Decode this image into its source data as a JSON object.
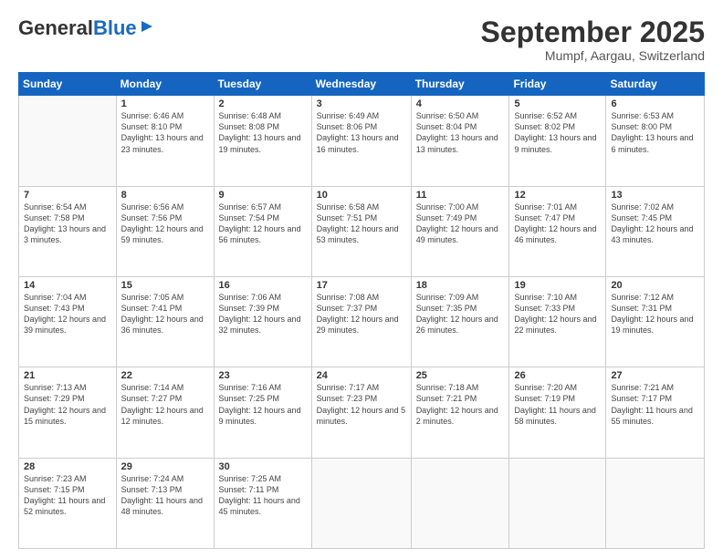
{
  "header": {
    "logo_general": "General",
    "logo_blue": "Blue",
    "month": "September 2025",
    "location": "Mumpf, Aargau, Switzerland"
  },
  "days_of_week": [
    "Sunday",
    "Monday",
    "Tuesday",
    "Wednesday",
    "Thursday",
    "Friday",
    "Saturday"
  ],
  "weeks": [
    [
      {
        "day": "",
        "sunrise": "",
        "sunset": "",
        "daylight": ""
      },
      {
        "day": "1",
        "sunrise": "Sunrise: 6:46 AM",
        "sunset": "Sunset: 8:10 PM",
        "daylight": "Daylight: 13 hours and 23 minutes."
      },
      {
        "day": "2",
        "sunrise": "Sunrise: 6:48 AM",
        "sunset": "Sunset: 8:08 PM",
        "daylight": "Daylight: 13 hours and 19 minutes."
      },
      {
        "day": "3",
        "sunrise": "Sunrise: 6:49 AM",
        "sunset": "Sunset: 8:06 PM",
        "daylight": "Daylight: 13 hours and 16 minutes."
      },
      {
        "day": "4",
        "sunrise": "Sunrise: 6:50 AM",
        "sunset": "Sunset: 8:04 PM",
        "daylight": "Daylight: 13 hours and 13 minutes."
      },
      {
        "day": "5",
        "sunrise": "Sunrise: 6:52 AM",
        "sunset": "Sunset: 8:02 PM",
        "daylight": "Daylight: 13 hours and 9 minutes."
      },
      {
        "day": "6",
        "sunrise": "Sunrise: 6:53 AM",
        "sunset": "Sunset: 8:00 PM",
        "daylight": "Daylight: 13 hours and 6 minutes."
      }
    ],
    [
      {
        "day": "7",
        "sunrise": "Sunrise: 6:54 AM",
        "sunset": "Sunset: 7:58 PM",
        "daylight": "Daylight: 13 hours and 3 minutes."
      },
      {
        "day": "8",
        "sunrise": "Sunrise: 6:56 AM",
        "sunset": "Sunset: 7:56 PM",
        "daylight": "Daylight: 12 hours and 59 minutes."
      },
      {
        "day": "9",
        "sunrise": "Sunrise: 6:57 AM",
        "sunset": "Sunset: 7:54 PM",
        "daylight": "Daylight: 12 hours and 56 minutes."
      },
      {
        "day": "10",
        "sunrise": "Sunrise: 6:58 AM",
        "sunset": "Sunset: 7:51 PM",
        "daylight": "Daylight: 12 hours and 53 minutes."
      },
      {
        "day": "11",
        "sunrise": "Sunrise: 7:00 AM",
        "sunset": "Sunset: 7:49 PM",
        "daylight": "Daylight: 12 hours and 49 minutes."
      },
      {
        "day": "12",
        "sunrise": "Sunrise: 7:01 AM",
        "sunset": "Sunset: 7:47 PM",
        "daylight": "Daylight: 12 hours and 46 minutes."
      },
      {
        "day": "13",
        "sunrise": "Sunrise: 7:02 AM",
        "sunset": "Sunset: 7:45 PM",
        "daylight": "Daylight: 12 hours and 43 minutes."
      }
    ],
    [
      {
        "day": "14",
        "sunrise": "Sunrise: 7:04 AM",
        "sunset": "Sunset: 7:43 PM",
        "daylight": "Daylight: 12 hours and 39 minutes."
      },
      {
        "day": "15",
        "sunrise": "Sunrise: 7:05 AM",
        "sunset": "Sunset: 7:41 PM",
        "daylight": "Daylight: 12 hours and 36 minutes."
      },
      {
        "day": "16",
        "sunrise": "Sunrise: 7:06 AM",
        "sunset": "Sunset: 7:39 PM",
        "daylight": "Daylight: 12 hours and 32 minutes."
      },
      {
        "day": "17",
        "sunrise": "Sunrise: 7:08 AM",
        "sunset": "Sunset: 7:37 PM",
        "daylight": "Daylight: 12 hours and 29 minutes."
      },
      {
        "day": "18",
        "sunrise": "Sunrise: 7:09 AM",
        "sunset": "Sunset: 7:35 PM",
        "daylight": "Daylight: 12 hours and 26 minutes."
      },
      {
        "day": "19",
        "sunrise": "Sunrise: 7:10 AM",
        "sunset": "Sunset: 7:33 PM",
        "daylight": "Daylight: 12 hours and 22 minutes."
      },
      {
        "day": "20",
        "sunrise": "Sunrise: 7:12 AM",
        "sunset": "Sunset: 7:31 PM",
        "daylight": "Daylight: 12 hours and 19 minutes."
      }
    ],
    [
      {
        "day": "21",
        "sunrise": "Sunrise: 7:13 AM",
        "sunset": "Sunset: 7:29 PM",
        "daylight": "Daylight: 12 hours and 15 minutes."
      },
      {
        "day": "22",
        "sunrise": "Sunrise: 7:14 AM",
        "sunset": "Sunset: 7:27 PM",
        "daylight": "Daylight: 12 hours and 12 minutes."
      },
      {
        "day": "23",
        "sunrise": "Sunrise: 7:16 AM",
        "sunset": "Sunset: 7:25 PM",
        "daylight": "Daylight: 12 hours and 9 minutes."
      },
      {
        "day": "24",
        "sunrise": "Sunrise: 7:17 AM",
        "sunset": "Sunset: 7:23 PM",
        "daylight": "Daylight: 12 hours and 5 minutes."
      },
      {
        "day": "25",
        "sunrise": "Sunrise: 7:18 AM",
        "sunset": "Sunset: 7:21 PM",
        "daylight": "Daylight: 12 hours and 2 minutes."
      },
      {
        "day": "26",
        "sunrise": "Sunrise: 7:20 AM",
        "sunset": "Sunset: 7:19 PM",
        "daylight": "Daylight: 11 hours and 58 minutes."
      },
      {
        "day": "27",
        "sunrise": "Sunrise: 7:21 AM",
        "sunset": "Sunset: 7:17 PM",
        "daylight": "Daylight: 11 hours and 55 minutes."
      }
    ],
    [
      {
        "day": "28",
        "sunrise": "Sunrise: 7:23 AM",
        "sunset": "Sunset: 7:15 PM",
        "daylight": "Daylight: 11 hours and 52 minutes."
      },
      {
        "day": "29",
        "sunrise": "Sunrise: 7:24 AM",
        "sunset": "Sunset: 7:13 PM",
        "daylight": "Daylight: 11 hours and 48 minutes."
      },
      {
        "day": "30",
        "sunrise": "Sunrise: 7:25 AM",
        "sunset": "Sunset: 7:11 PM",
        "daylight": "Daylight: 11 hours and 45 minutes."
      },
      {
        "day": "",
        "sunrise": "",
        "sunset": "",
        "daylight": ""
      },
      {
        "day": "",
        "sunrise": "",
        "sunset": "",
        "daylight": ""
      },
      {
        "day": "",
        "sunrise": "",
        "sunset": "",
        "daylight": ""
      },
      {
        "day": "",
        "sunrise": "",
        "sunset": "",
        "daylight": ""
      }
    ]
  ]
}
